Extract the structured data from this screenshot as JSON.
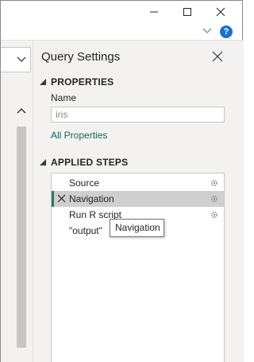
{
  "window": {
    "help_label": "?"
  },
  "query_settings": {
    "title": "Query Settings",
    "properties": {
      "heading": "PROPERTIES",
      "name_label": "Name",
      "name_value": "iris",
      "all_properties_link": "All Properties"
    },
    "applied_steps": {
      "heading": "APPLIED STEPS",
      "steps": [
        {
          "label": "Source",
          "has_gear": true,
          "selected": false
        },
        {
          "label": "Navigation",
          "has_gear": true,
          "selected": true
        },
        {
          "label": "Run R script",
          "has_gear": true,
          "selected": false
        },
        {
          "label": "\"output\"",
          "has_gear": false,
          "selected": false
        }
      ]
    },
    "tooltip": "Navigation"
  },
  "colors": {
    "accent": "#2b7a5d",
    "link": "#0b6a53",
    "help": "#1f6fd0",
    "pane_bg": "#f3f2f1"
  }
}
